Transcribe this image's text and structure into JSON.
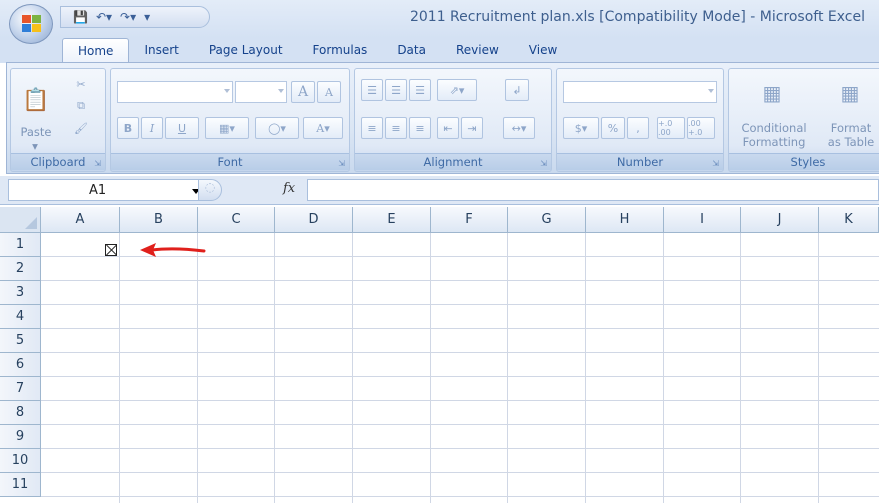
{
  "window": {
    "title": "2011 Recruitment plan.xls  [Compatibility Mode]  -  Microsoft Excel"
  },
  "qat": {
    "save_icon": "save-icon",
    "undo_icon": "undo-icon",
    "redo_icon": "redo-icon",
    "customize_icon": "chevron-down-icon"
  },
  "tabs": [
    {
      "label": "Home",
      "active": true
    },
    {
      "label": "Insert"
    },
    {
      "label": "Page Layout"
    },
    {
      "label": "Formulas"
    },
    {
      "label": "Data"
    },
    {
      "label": "Review"
    },
    {
      "label": "View"
    }
  ],
  "ribbon": {
    "clipboard": {
      "label": "Clipboard",
      "paste": "Paste"
    },
    "font": {
      "label": "Font",
      "font_name": "",
      "font_size": "",
      "bold": "B",
      "italic": "I",
      "underline": "U",
      "grow": "A",
      "shrink": "A",
      "font_color": "A"
    },
    "alignment": {
      "label": "Alignment"
    },
    "number": {
      "label": "Number",
      "format": "",
      "percent": "%",
      "comma": ",",
      "inc_decimal": "+.0 .00",
      "dec_decimal": ".00 +.0"
    },
    "styles": {
      "label": "Styles",
      "conditional_formatting": "Conditional",
      "conditional_formatting_2": "Formatting",
      "format_as_table": "Format",
      "format_as_table_2": "as Table"
    }
  },
  "formula_bar": {
    "name_box": "A1",
    "fx": "fx",
    "formula": ""
  },
  "grid": {
    "columns": [
      "A",
      "B",
      "C",
      "D",
      "E",
      "F",
      "G",
      "H",
      "I",
      "J",
      "K"
    ],
    "rows": [
      "1",
      "2",
      "3",
      "4",
      "5",
      "6",
      "7",
      "8",
      "9",
      "10",
      "11"
    ],
    "annotation_color": "#e0201c"
  }
}
